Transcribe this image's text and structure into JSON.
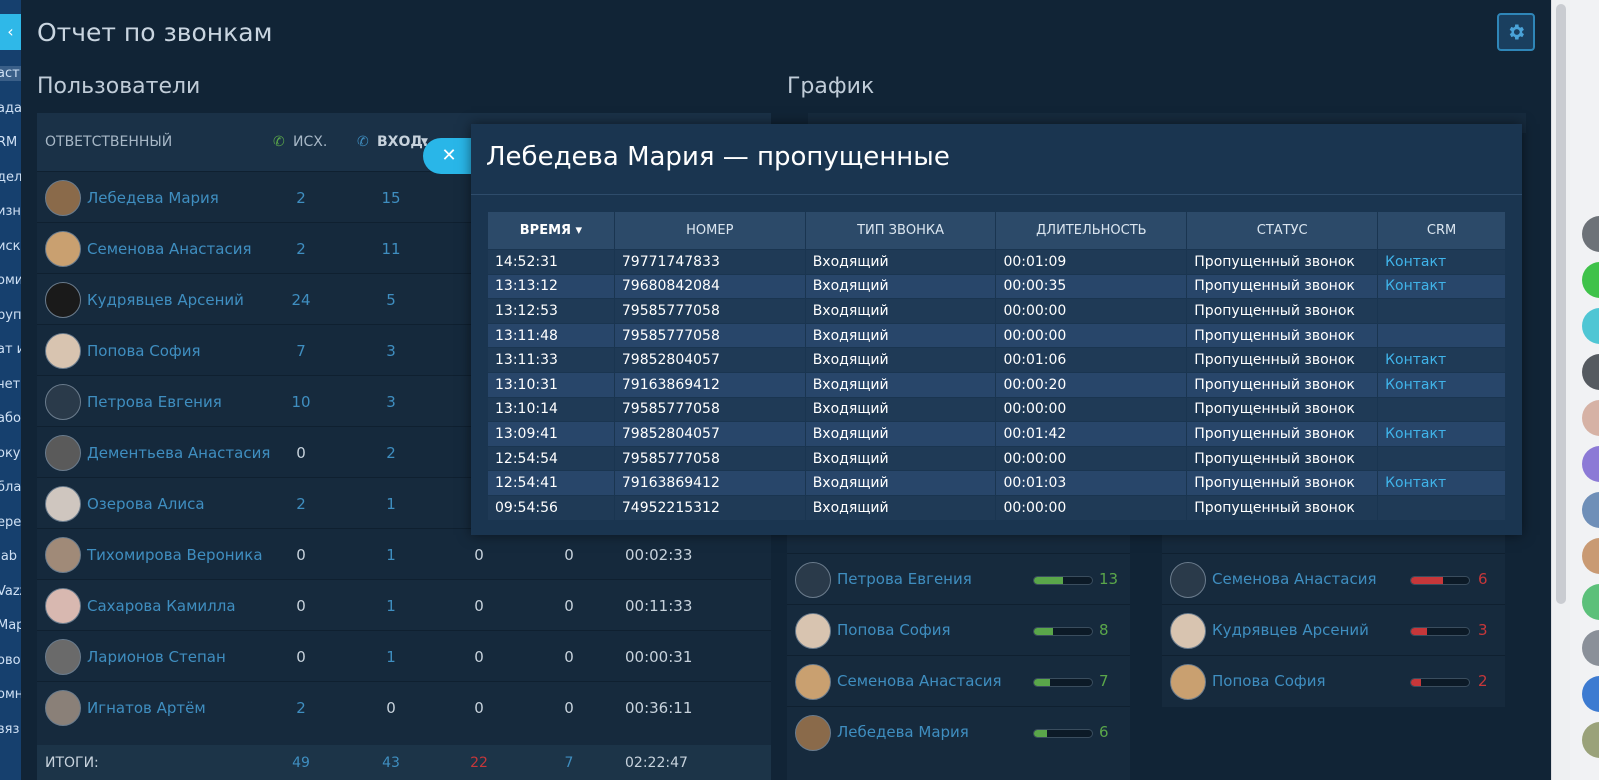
{
  "crm_sidebar": {
    "back_icon": "chevron-left-icon",
    "items": [
      "аст",
      "ада",
      "RM",
      "дел",
      "изн",
      "иск",
      "оми",
      "руп",
      "ат и",
      "чет",
      "або",
      "оку",
      "бла",
      "ере",
      "Jab",
      "Vazz",
      "Мар",
      "ово",
      "омн",
      "вяз"
    ]
  },
  "page": {
    "title": "Отчет по звонкам",
    "settings_icon": "gear-icon"
  },
  "users": {
    "title": "Пользователи",
    "headers": {
      "responsible": "ОТВЕТСТВЕННЫЙ",
      "outgoing": "ИСХ.",
      "incoming": "ВХОД."
    },
    "rows": [
      {
        "name": "Лебедева Мария",
        "out": "2",
        "in": "15",
        "c3": "",
        "c4": "",
        "time": ""
      },
      {
        "name": "Семенова Анастасия",
        "out": "2",
        "in": "11",
        "c3": "",
        "c4": "",
        "time": ""
      },
      {
        "name": "Кудрявцев Арсений",
        "out": "24",
        "in": "5",
        "c3": "",
        "c4": "",
        "time": ""
      },
      {
        "name": "Попова София",
        "out": "7",
        "in": "3",
        "c3": "",
        "c4": "",
        "time": ""
      },
      {
        "name": "Петрова Евгения",
        "out": "10",
        "in": "3",
        "c3": "",
        "c4": "",
        "time": ""
      },
      {
        "name": "Дементьева Анастасия",
        "out": "0",
        "in": "2",
        "c3": "",
        "c4": "",
        "time": ""
      },
      {
        "name": "Озерова Алиса",
        "out": "2",
        "in": "1",
        "c3": "",
        "c4": "",
        "time": ""
      },
      {
        "name": "Тихомирова Вероника",
        "out": "0",
        "in": "1",
        "c3": "0",
        "c4": "0",
        "time": "00:02:33"
      },
      {
        "name": "Сахарова Камилла",
        "out": "0",
        "in": "1",
        "c3": "0",
        "c4": "0",
        "time": "00:11:33"
      },
      {
        "name": "Ларионов Степан",
        "out": "0",
        "in": "1",
        "c3": "0",
        "c4": "0",
        "time": "00:00:31"
      },
      {
        "name": "Игнатов Артём",
        "out": "2",
        "in": "0",
        "c3": "0",
        "c4": "0",
        "time": "00:36:11"
      }
    ],
    "totals": {
      "label": "ИТОГИ:",
      "out": "49",
      "in": "43",
      "missed": "22",
      "c4": "7",
      "time": "02:22:47"
    }
  },
  "chart": {
    "title": "График"
  },
  "rank_left": [
    {
      "name": "Петрова Евгения",
      "value": "13",
      "fraction": 0.5
    },
    {
      "name": "Попова София",
      "value": "8",
      "fraction": 0.32
    },
    {
      "name": "Семенова Анастасия",
      "value": "7",
      "fraction": 0.28
    },
    {
      "name": "Лебедева Мария",
      "value": "6",
      "fraction": 0.22
    }
  ],
  "rank_right": [
    {
      "name": "Семенова Анастасия",
      "value": "6",
      "fraction": 0.55
    },
    {
      "name": "Кудрявцев Арсений",
      "value": "3",
      "fraction": 0.28
    },
    {
      "name": "Попова София",
      "value": "2",
      "fraction": 0.18
    }
  ],
  "colors": {
    "accent": "#29b6e8",
    "link": "#3f8ec0",
    "green": "#5aa64a",
    "red": "#c6373a"
  },
  "modal": {
    "title": "Лебедева Мария — пропущенные",
    "close_icon": "close-icon",
    "columns": [
      "ВРЕМЯ",
      "НОМЕР",
      "ТИП ЗВОНКА",
      "ДЛИТЕЛЬНОСТЬ",
      "СТАТУС",
      "CRM"
    ],
    "rows": [
      [
        "14:52:31",
        "79771747833",
        "Входящий",
        "00:01:09",
        "Пропущенный звонок",
        "Контакт"
      ],
      [
        "13:13:12",
        "79680842084",
        "Входящий",
        "00:00:35",
        "Пропущенный звонок",
        "Контакт"
      ],
      [
        "13:12:53",
        "79585777058",
        "Входящий",
        "00:00:00",
        "Пропущенный звонок",
        ""
      ],
      [
        "13:11:48",
        "79585777058",
        "Входящий",
        "00:00:00",
        "Пропущенный звонок",
        ""
      ],
      [
        "13:11:33",
        "79852804057",
        "Входящий",
        "00:01:06",
        "Пропущенный звонок",
        "Контакт"
      ],
      [
        "13:10:31",
        "79163869412",
        "Входящий",
        "00:00:20",
        "Пропущенный звонок",
        "Контакт"
      ],
      [
        "13:10:14",
        "79585777058",
        "Входящий",
        "00:00:00",
        "Пропущенный звонок",
        ""
      ],
      [
        "13:09:41",
        "79852804057",
        "Входящий",
        "00:01:42",
        "Пропущенный звонок",
        "Контакт"
      ],
      [
        "12:54:54",
        "79585777058",
        "Входящий",
        "00:00:00",
        "Пропущенный звонок",
        ""
      ],
      [
        "12:54:41",
        "79163869412",
        "Входящий",
        "00:01:03",
        "Пропущенный звонок",
        "Контакт"
      ],
      [
        "09:54:56",
        "74952215312",
        "Входящий",
        "00:00:00",
        "Пропущенный звонок",
        ""
      ]
    ]
  }
}
